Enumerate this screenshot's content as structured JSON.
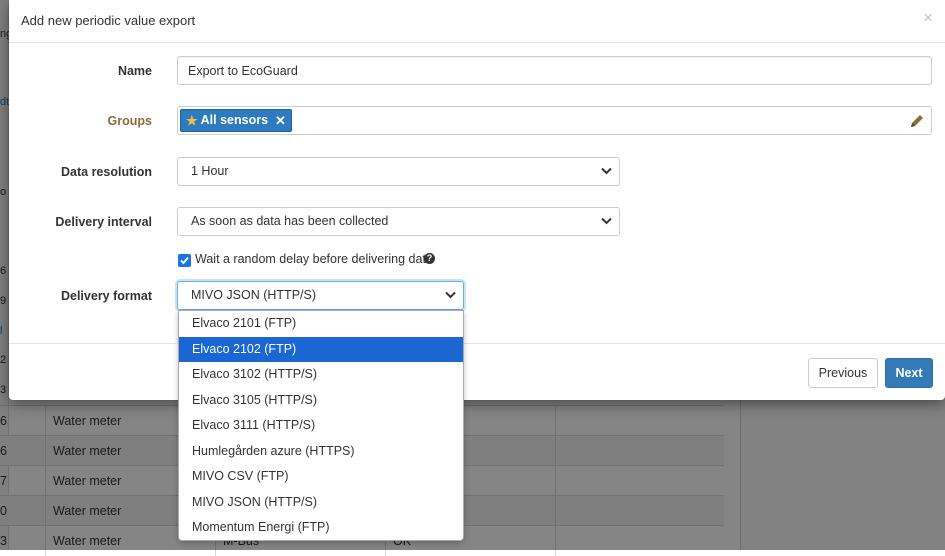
{
  "modal": {
    "title": "Add new periodic value export",
    "close_symbol": "×",
    "name": {
      "label": "Name",
      "value": "Export to EcoGuard"
    },
    "groups": {
      "label": "Groups",
      "tag": "All sensors",
      "tag_remove_symbol": "✕"
    },
    "data_resolution": {
      "label": "Data resolution",
      "value": "1 Hour"
    },
    "delivery_interval": {
      "label": "Delivery interval",
      "value": "As soon as data has been collected"
    },
    "random_delay": {
      "label": "Wait a random delay before delivering data",
      "checked": true,
      "help_symbol": "?"
    },
    "delivery_format": {
      "label": "Delivery format",
      "value": "MIVO JSON (HTTP/S)",
      "highlighted_option": "Elvaco 2102 (FTP)",
      "options": [
        "Elvaco 2101 (FTP)",
        "Elvaco 2102 (FTP)",
        "Elvaco 3102 (HTTP/S)",
        "Elvaco 3105 (HTTP/S)",
        "Elvaco 3111 (HTTP/S)",
        "Humlegården azure (HTTPS)",
        "MIVO CSV (FTP)",
        "MIVO JSON (HTTP/S)",
        "Momentum Energi (FTP)"
      ]
    },
    "buttons": {
      "previous": "Previous",
      "next": "Next"
    }
  },
  "background": {
    "edge_fragments": [
      "ng",
      "dt",
      "o",
      "6",
      "9",
      "l",
      "2",
      "3",
      "6",
      "6",
      "7",
      "0",
      "3"
    ],
    "rows": [
      {
        "c0": "6",
        "type": "Water meter",
        "c2": "",
        "c3": ""
      },
      {
        "c0": "6",
        "type": "Water meter",
        "c2": "",
        "c3": ""
      },
      {
        "c0": "7",
        "type": "Water meter",
        "c2": "",
        "c3": ""
      },
      {
        "c0": "0",
        "type": "Water meter",
        "c2": "",
        "c3": ""
      },
      {
        "c0": "3",
        "type": "Water meter",
        "c2": "M-Bus",
        "c3": "OK"
      }
    ]
  },
  "colors": {
    "tag_background": "#2f7bbf",
    "primary_button": "#337ab7",
    "dropdown_highlight": "#1a66d2",
    "groups_label": "#8a6d3b"
  }
}
